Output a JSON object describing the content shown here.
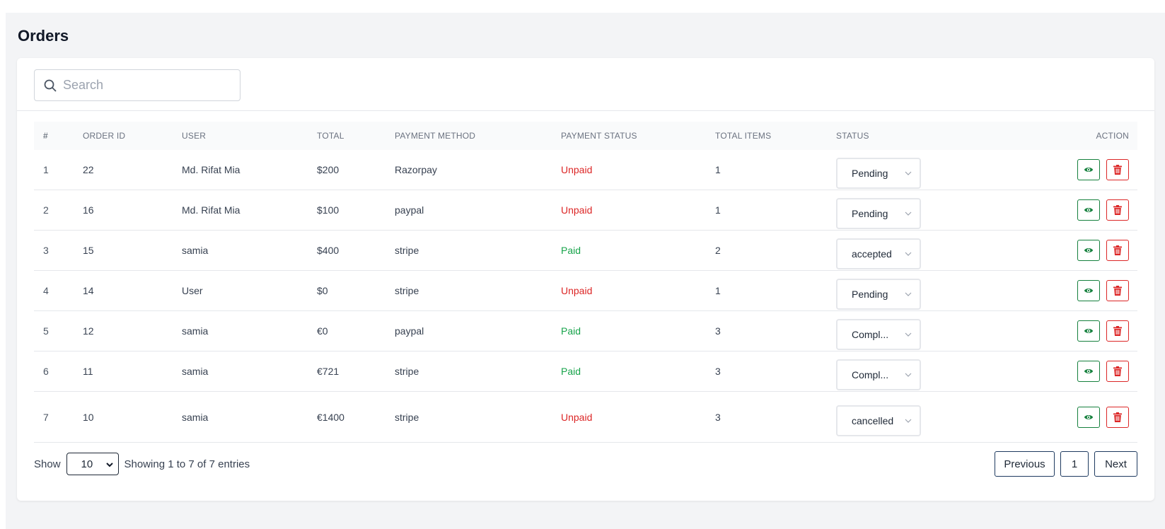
{
  "page": {
    "title": "Orders"
  },
  "search": {
    "placeholder": "Search"
  },
  "table": {
    "headers": [
      "#",
      "Order ID",
      "User",
      "Total",
      "Payment Method",
      "Payment Status",
      "Total Items",
      "Status",
      "Action"
    ],
    "rows": [
      {
        "idx": "1",
        "order_id": "22",
        "user": "Md. Rifat Mia",
        "total": "$200",
        "method": "Razorpay",
        "payment_status": "Unpaid",
        "items": "1",
        "status": "Pending"
      },
      {
        "idx": "2",
        "order_id": "16",
        "user": "Md. Rifat Mia",
        "total": "$100",
        "method": "paypal",
        "payment_status": "Unpaid",
        "items": "1",
        "status": "Pending"
      },
      {
        "idx": "3",
        "order_id": "15",
        "user": "samia",
        "total": "$400",
        "method": "stripe",
        "payment_status": "Paid",
        "items": "2",
        "status": "accepted"
      },
      {
        "idx": "4",
        "order_id": "14",
        "user": "User",
        "total": "$0",
        "method": "stripe",
        "payment_status": "Unpaid",
        "items": "1",
        "status": "Pending"
      },
      {
        "idx": "5",
        "order_id": "12",
        "user": "samia",
        "total": "€0",
        "method": "paypal",
        "payment_status": "Paid",
        "items": "3",
        "status": "Compl..."
      },
      {
        "idx": "6",
        "order_id": "11",
        "user": "samia",
        "total": "€721",
        "method": "stripe",
        "payment_status": "Paid",
        "items": "3",
        "status": "Compl..."
      },
      {
        "idx": "7",
        "order_id": "10",
        "user": "samia",
        "total": "€1400",
        "method": "stripe",
        "payment_status": "Unpaid",
        "items": "3",
        "status": "cancelled"
      }
    ]
  },
  "footer": {
    "show_label": "Show",
    "page_size": "10",
    "showing_text": "Showing 1 to 7 of 7 entries",
    "previous_label": "Previous",
    "current_page": "1",
    "next_label": "Next"
  },
  "colors": {
    "paid": "#16a34a",
    "unpaid": "#dc2626",
    "view": "#15803d",
    "delete": "#dc2626"
  },
  "icons": {
    "search": "search-icon",
    "view": "eye-icon",
    "delete": "trash-icon",
    "dropdown": "chevron-down-icon"
  }
}
